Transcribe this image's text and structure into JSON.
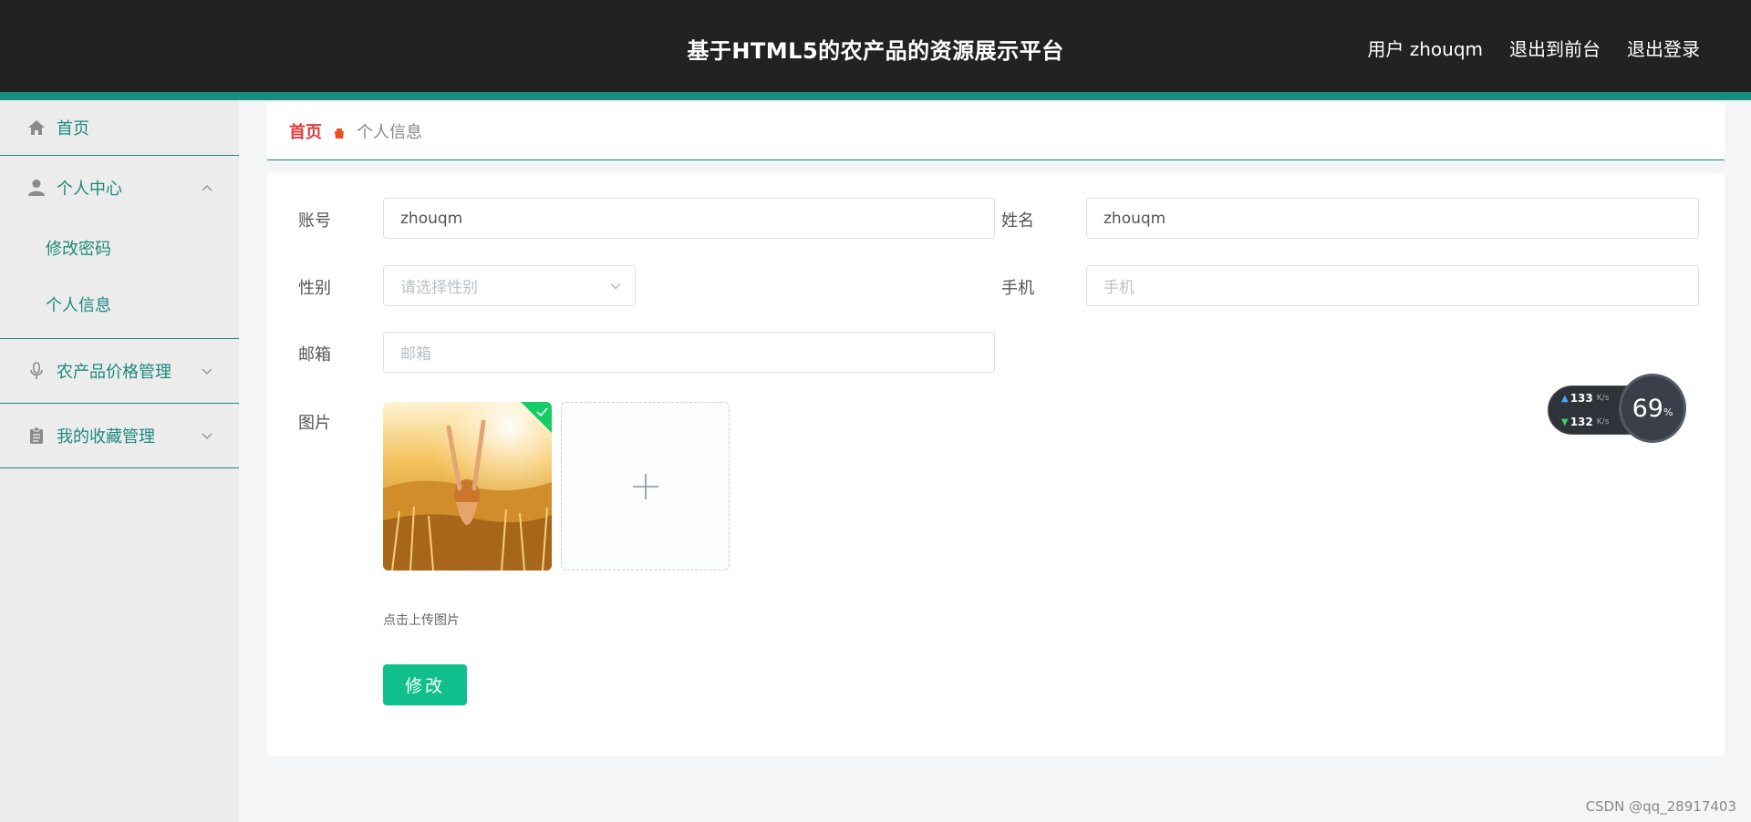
{
  "header": {
    "title": "基于HTML5的农产品的资源展示平台",
    "user_label": "用户 zhouqm",
    "back_front_label": "退出到前台",
    "logout_label": "退出登录"
  },
  "sidebar": {
    "home": "首页",
    "personal_center": "个人中心",
    "change_password": "修改密码",
    "personal_info": "个人信息",
    "price_mgmt": "农产品价格管理",
    "favorites_mgmt": "我的收藏管理"
  },
  "breadcrumb": {
    "home": "首页",
    "current": "个人信息"
  },
  "form": {
    "account_label": "账号",
    "account_value": "zhouqm",
    "name_label": "姓名",
    "name_value": "zhouqm",
    "gender_label": "性别",
    "gender_placeholder": "请选择性别",
    "phone_label": "手机",
    "phone_placeholder": "手机",
    "email_label": "邮箱",
    "email_placeholder": "邮箱",
    "image_label": "图片",
    "upload_hint": "点击上传图片",
    "submit_label": "修改"
  },
  "speed_widget": {
    "upload": "133",
    "download": "132",
    "unit": "K/s",
    "percent": "69",
    "percent_sign": "%"
  },
  "watermark": "CSDN @qq_28917403",
  "colors": {
    "header_bg": "#222222",
    "accent": "#188d80",
    "button": "#0fbf8c",
    "breadcrumb_home": "#e4393c"
  }
}
